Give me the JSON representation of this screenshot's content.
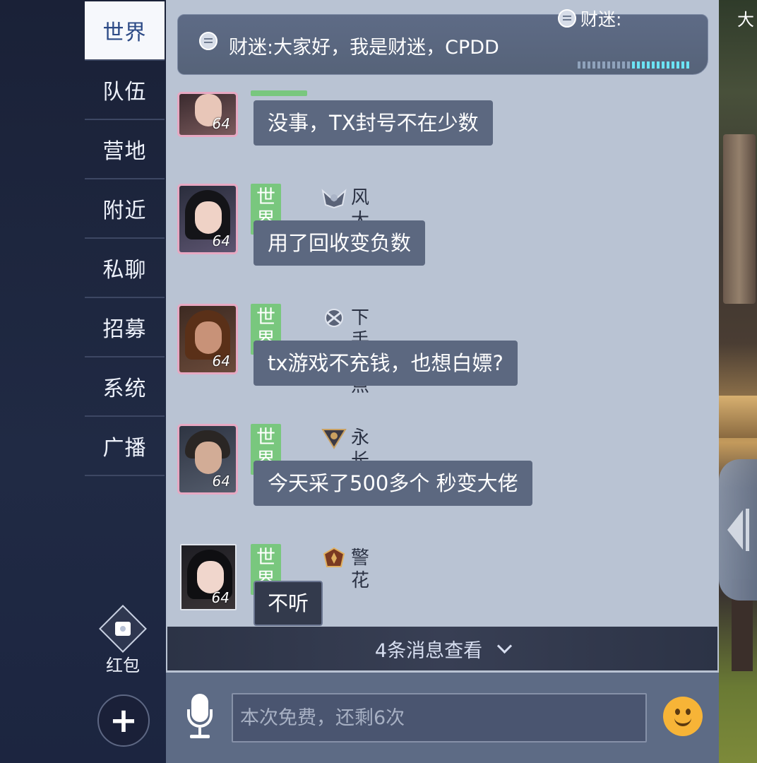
{
  "sidebar": {
    "tabs": [
      {
        "label": "世界",
        "active": true
      },
      {
        "label": "队伍",
        "active": false
      },
      {
        "label": "营地",
        "active": false
      },
      {
        "label": "附近",
        "active": false
      },
      {
        "label": "私聊",
        "active": false
      },
      {
        "label": "招募",
        "active": false
      },
      {
        "label": "系统",
        "active": false
      },
      {
        "label": "广播",
        "active": false
      }
    ],
    "red_packet_label": "红包",
    "plus_label": "+"
  },
  "scene": {
    "corner_text": "大"
  },
  "pinned_broadcast": {
    "text": "财迷:大家好，我是财迷，CPDD",
    "overlay_sender": "财迷:"
  },
  "messages": [
    {
      "channel": "",
      "sender": "",
      "level": "64",
      "text": "没事，TX封号不在少数"
    },
    {
      "channel": "世界",
      "sender": "风大大",
      "level": "64",
      "text": "用了回收变负数"
    },
    {
      "channel": "世界",
      "sender": "下手轻点",
      "level": "64",
      "text": "tx游戏不充钱，也想白嫖?"
    },
    {
      "channel": "世界",
      "sender": "永长青",
      "level": "64",
      "text": "今天采了500多个  秒变大佬"
    },
    {
      "channel": "世界",
      "sender": "警花",
      "level": "64",
      "text": "不听"
    }
  ],
  "new_messages_bar": {
    "label": "4条消息查看"
  },
  "input": {
    "placeholder": "本次免费，还剩6次"
  },
  "colors": {
    "channel_tag": "#79c77e",
    "bubble": "#5c6880",
    "chat_bg": "#b9c3d3",
    "sidebar_bg": "#1a2137"
  }
}
